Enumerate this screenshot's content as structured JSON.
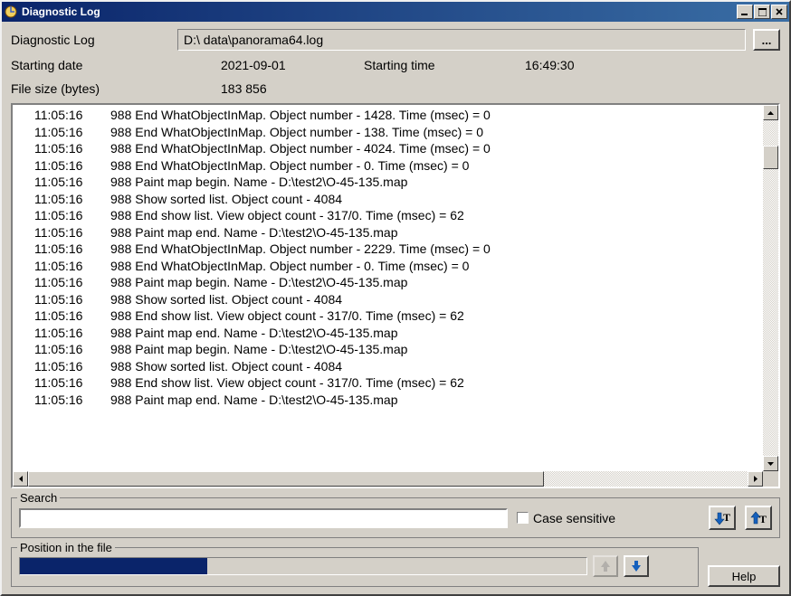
{
  "window": {
    "title": "Diagnostic Log"
  },
  "header": {
    "label": "Diagnostic Log",
    "path": "D:\\ data\\panorama64.log"
  },
  "info": {
    "starting_date_label": "Starting date",
    "starting_date": "2021-09-01",
    "starting_time_label": "Starting time",
    "starting_time": "16:49:30",
    "file_size_label": "File size (bytes)",
    "file_size": "183 856"
  },
  "log_lines": [
    {
      "time": "11:05:16",
      "text": "988 End WhatObjectInMap. Object number - 1428. Time (msec) = 0"
    },
    {
      "time": "11:05:16",
      "text": "988 End WhatObjectInMap. Object number - 138. Time (msec) = 0"
    },
    {
      "time": "11:05:16",
      "text": "988 End WhatObjectInMap. Object number - 4024. Time (msec) = 0"
    },
    {
      "time": "11:05:16",
      "text": "988 End WhatObjectInMap. Object number - 0. Time (msec) = 0"
    },
    {
      "time": "11:05:16",
      "text": "988 Paint map begin. Name - D:\\test2\\O-45-135.map"
    },
    {
      "time": "11:05:16",
      "text": "988 Show sorted list. Object count - 4084"
    },
    {
      "time": "11:05:16",
      "text": "988 End show list. View object count - 317/0. Time (msec) = 62"
    },
    {
      "time": "11:05:16",
      "text": "988 Paint map end. Name - D:\\test2\\O-45-135.map"
    },
    {
      "time": "11:05:16",
      "text": "988 End WhatObjectInMap. Object number - 2229. Time (msec) = 0"
    },
    {
      "time": "11:05:16",
      "text": "988 End WhatObjectInMap. Object number - 0. Time (msec) = 0"
    },
    {
      "time": "11:05:16",
      "text": "988 Paint map begin. Name - D:\\test2\\O-45-135.map"
    },
    {
      "time": "11:05:16",
      "text": "988 Show sorted list. Object count - 4084"
    },
    {
      "time": "11:05:16",
      "text": "988 End show list. View object count - 317/0. Time (msec) = 62"
    },
    {
      "time": "11:05:16",
      "text": "988 Paint map end. Name - D:\\test2\\O-45-135.map"
    },
    {
      "time": "11:05:16",
      "text": "988 Paint map begin. Name - D:\\test2\\O-45-135.map"
    },
    {
      "time": "11:05:16",
      "text": "988 Show sorted list. Object count - 4084"
    },
    {
      "time": "11:05:16",
      "text": "988 End show list. View object count - 317/0. Time (msec) = 62"
    },
    {
      "time": "11:05:16",
      "text": "988 Paint map end. Name - D:\\test2\\O-45-135.map"
    }
  ],
  "search": {
    "legend": "Search",
    "value": "",
    "case_sensitive_label": "Case sensitive"
  },
  "position": {
    "legend": "Position in the file"
  },
  "buttons": {
    "help": "Help",
    "browse": "..."
  }
}
